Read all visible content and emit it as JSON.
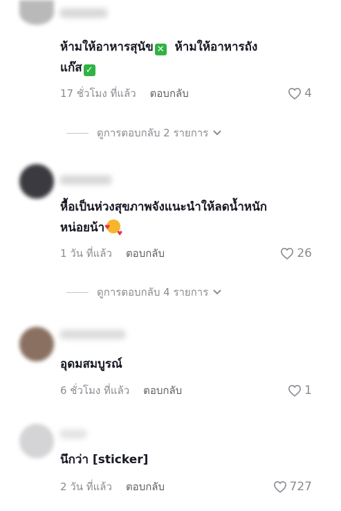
{
  "comments": [
    {
      "text_line1": "ห้ามให้อาหารสุนัข",
      "text_line1b": "ห้ามให้อาหารถัง",
      "text_line2": "แก๊ส",
      "time": "17 ชั่วโมง ที่แล้ว",
      "reply_label": "ตอบกลับ",
      "likes": "4",
      "view_replies": "ดูการตอบกลับ 2 รายการ"
    },
    {
      "text_line1": "หื้อเป็นห่วงสุขภาพจังแนะนำให้ลดน้ำหนัก",
      "text_line2": "หน่อยน้า",
      "time": "1 วัน ที่แล้ว",
      "reply_label": "ตอบกลับ",
      "likes": "26",
      "view_replies": "ดูการตอบกลับ 4 รายการ"
    },
    {
      "text_line1": "อุดมสมบูรณ์",
      "time": "6 ชั่วโมง ที่แล้ว",
      "reply_label": "ตอบกลับ",
      "likes": "1"
    },
    {
      "text_line1": "นึกว่า [sticker]",
      "time": "2 วัน ที่แล้ว",
      "reply_label": "ตอบกลับ",
      "likes": "727"
    }
  ],
  "icons": {
    "heart": "heart-icon",
    "chevron": "chevron-down-icon",
    "cross_mark": "cross-mark-emoji",
    "check_mark": "check-mark-emoji",
    "smiling_hearts": "smiling-face-with-hearts-emoji"
  },
  "colors": {
    "text": "#161823",
    "meta": "#8a8b91",
    "emoji_green": "#2fb344"
  }
}
